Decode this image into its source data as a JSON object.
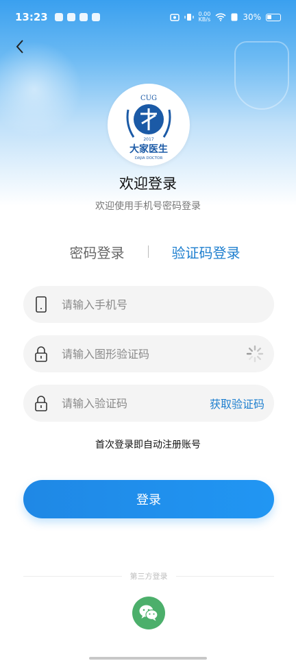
{
  "status_bar": {
    "time": "13:23",
    "net_speed_value": "0.00",
    "net_speed_unit": "KB/s",
    "battery": "30%"
  },
  "header": {
    "title": "欢迎登录",
    "subtitle": "欢迎使用手机号密码登录"
  },
  "logo": {
    "top_text": "CUG",
    "year": "2017",
    "name": "大家医生",
    "english": "DAJIA DOCTOR"
  },
  "tabs": {
    "password": "密码登录",
    "code": "验证码登录",
    "active": "code"
  },
  "form": {
    "phone_placeholder": "请输入手机号",
    "captcha_placeholder": "请输入图形验证码",
    "sms_placeholder": "请输入验证码",
    "get_code_label": "获取验证码"
  },
  "note": "首次登录即自动注册账号",
  "login_button": "登录",
  "third_party_label": "第三方登录",
  "colors": {
    "accent": "#1e7fcf",
    "button": "#2196f3",
    "wechat": "#4caf6b"
  }
}
